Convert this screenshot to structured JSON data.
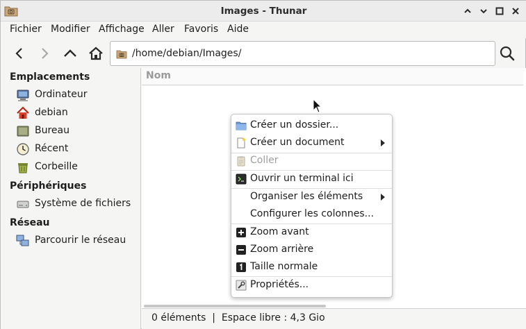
{
  "window": {
    "title": "Images - Thunar"
  },
  "menubar": [
    "Fichier",
    "Modifier",
    "Affichage",
    "Aller",
    "Favoris",
    "Aide"
  ],
  "location": {
    "path": "/home/debian/Images/"
  },
  "sidebar": {
    "sections": [
      {
        "title": "Emplacements",
        "items": [
          "Ordinateur",
          "debian",
          "Bureau",
          "Récent",
          "Corbeille"
        ]
      },
      {
        "title": "Périphériques",
        "items": [
          "Système de fichiers"
        ]
      },
      {
        "title": "Réseau",
        "items": [
          "Parcourir le réseau"
        ]
      }
    ]
  },
  "main": {
    "column_header": "Nom"
  },
  "statusbar": {
    "text": "0 éléments  |  Espace libre : 4,3 Gio"
  },
  "context_menu": {
    "items": [
      {
        "label": "Créer un dossier...",
        "icon": "folder-new-icon"
      },
      {
        "label": "Créer un document",
        "icon": "document-new-icon",
        "submenu": true
      },
      {
        "label": "Coller",
        "icon": "paste-icon",
        "disabled": true
      },
      {
        "label": "Ouvrir un terminal ici",
        "icon": "terminal-icon"
      },
      {
        "label": "Organiser les éléments",
        "submenu": true
      },
      {
        "label": "Configurer les colonnes..."
      },
      {
        "label": "Zoom avant",
        "icon": "zoom-in-icon"
      },
      {
        "label": "Zoom arrière",
        "icon": "zoom-out-icon"
      },
      {
        "label": "Taille normale",
        "icon": "zoom-normal-icon"
      },
      {
        "label": "Propriétés...",
        "icon": "properties-icon"
      }
    ]
  },
  "colors": {
    "accent": "#3c7fc4",
    "folder": "#c8a87a",
    "home": "#d6402c",
    "window_bg": "#f5f5f4"
  }
}
